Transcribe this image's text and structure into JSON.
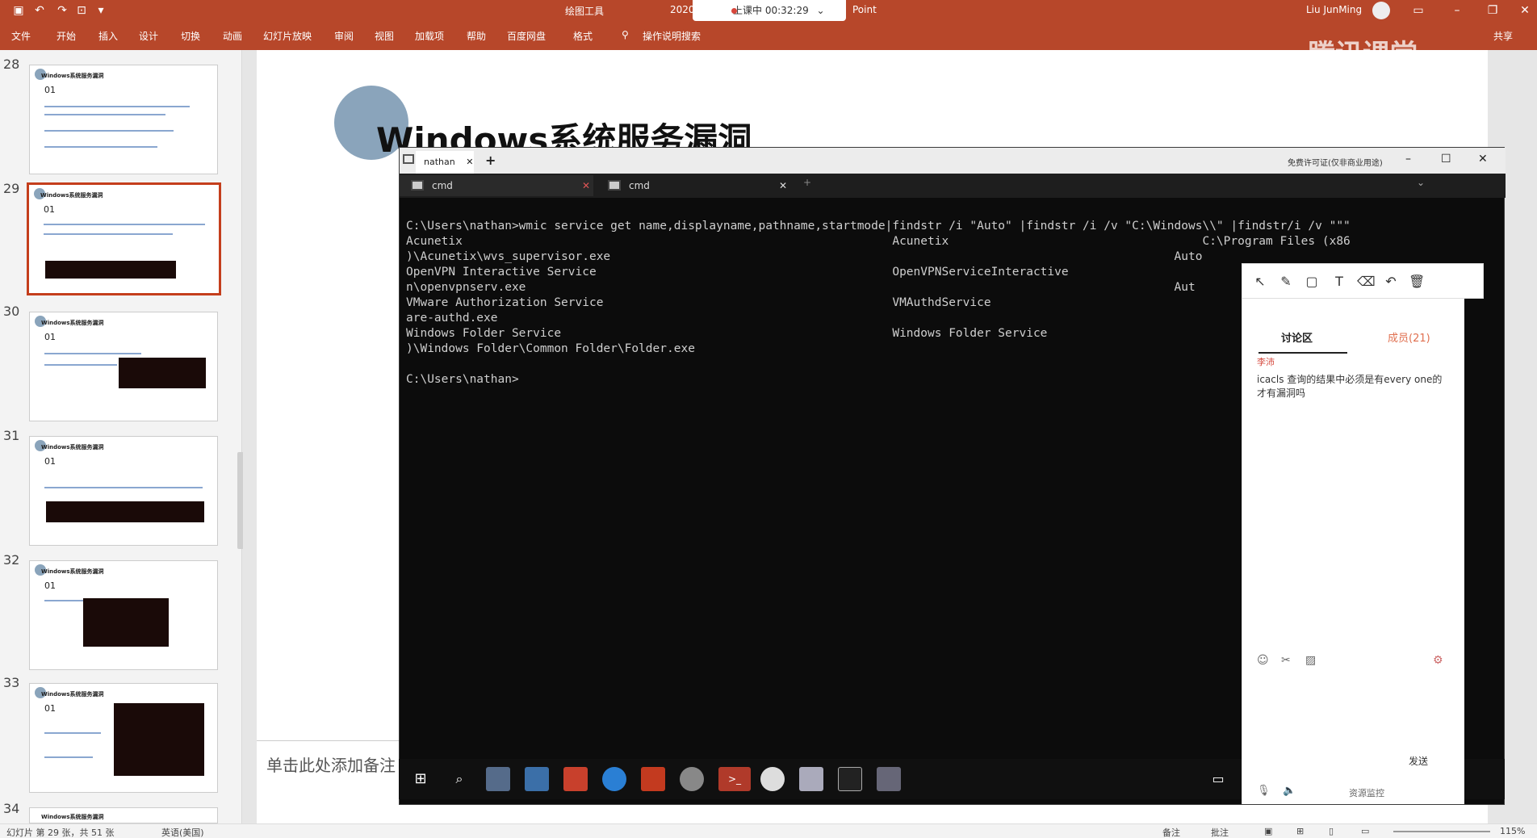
{
  "titlebar": {
    "tool_label": "绘图工具",
    "year_fragment": "2020",
    "app_fragment": "Point",
    "recording_status": "上课中 00:32:29",
    "user_name": "Liu JunMing"
  },
  "ribbon": {
    "tabs": [
      "文件",
      "开始",
      "插入",
      "设计",
      "切换",
      "动画",
      "幻灯片放映",
      "审阅",
      "视图",
      "加载项",
      "帮助",
      "百度网盘",
      "格式"
    ],
    "search_label": "操作说明搜索",
    "share_label": "共享"
  },
  "watermark": "腾讯课堂",
  "thumbnails": [
    {
      "num": "28",
      "title": "Windows系统服务漏洞",
      "section": "01"
    },
    {
      "num": "29",
      "title": "Windows系统服务漏洞",
      "section": "01"
    },
    {
      "num": "30",
      "title": "Windows系统服务漏洞",
      "section": "01"
    },
    {
      "num": "31",
      "title": "Windows系统服务漏洞",
      "section": "01"
    },
    {
      "num": "32",
      "title": "Windows系统服务漏洞",
      "section": "01"
    },
    {
      "num": "33",
      "title": "Windows系统服务漏洞",
      "section": "01"
    },
    {
      "num": "34",
      "title": "Windows系统服务漏洞",
      "section": ""
    }
  ],
  "slide": {
    "title": "Windows系统服务漏洞",
    "notes_placeholder": "单击此处添加备注"
  },
  "terminal": {
    "window_tab": "nathan",
    "top_note": "免费许可证(仅非商业用途)",
    "subtabs": [
      "cmd",
      "cmd"
    ],
    "lines": [
      "C:\\Users\\nathan>wmic service get name,displayname,pathname,startmode|findstr /i \"Auto\" |findstr /i /v \"C:\\Windows\\\\\" |findstr/i /v \"\"\"",
      "Acunetix                                                             Acunetix                                    C:\\Program Files (x86",
      ")\\Acunetix\\wvs_supervisor.exe                                                                                Auto",
      "OpenVPN Interactive Service                                          OpenVPNServiceInteractive",
      "n\\openvpnserv.exe                                                                                            Aut",
      "VMware Authorization Service                                         VMAuthdService                                                   mw",
      "are-authd.exe",
      "Windows Folder Service                                               Windows Folder Service                                           86",
      ")\\Windows Folder\\Common Folder\\Folder.exe",
      "",
      "C:\\Users\\nathan>"
    ]
  },
  "chat": {
    "tab_discussion": "讨论区",
    "tab_members": "成员(21)",
    "message_user": "李沛",
    "message_text": "icacls 查询的结果中必须是有every one的才有漏洞吗",
    "send_label": "发送",
    "resource_label": "资源监控"
  },
  "statusbar": {
    "slide_info": "幻灯片 第 29 张，共 51 张",
    "language": "英语(美国)",
    "notes_label": "备注",
    "comments_label": "批注",
    "zoom": "115%"
  },
  "colors": {
    "accent": "#b7472a",
    "selected_border": "#c43e1c",
    "terminal_bg": "#0c0c0c"
  }
}
